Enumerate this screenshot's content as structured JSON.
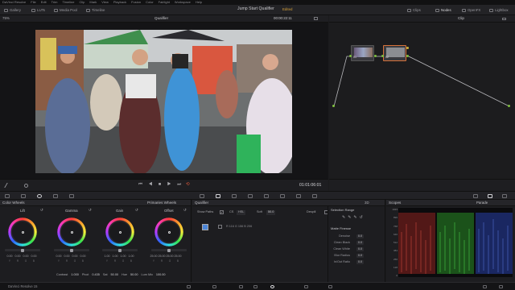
{
  "menu": [
    "DaVinci Resolve",
    "File",
    "Edit",
    "Trim",
    "Timeline",
    "Clip",
    "Mark",
    "View",
    "Playback",
    "Fusion",
    "Color",
    "Fairlight",
    "Workspace",
    "Help"
  ],
  "toolbar": {
    "left": [
      "Gallery",
      "LUTs",
      "Media Pool",
      "Timeline"
    ],
    "project_title": "Jump Start Qualifier",
    "project_status": "Edited",
    "right": [
      "Clips",
      "Nodes",
      "OpenFX",
      "Lightbox"
    ]
  },
  "viewer": {
    "zoom": "75%",
    "mode": "Qualifier",
    "timecode_top": "00:00:22:11",
    "timecode": "01:01:06:01"
  },
  "node_header": {
    "mode": "Clip"
  },
  "nodes": [
    {
      "num": "01"
    },
    {
      "num": "02"
    }
  ],
  "color_wheels": {
    "title": "Color Wheels",
    "tab": "Primaries Wheels",
    "wheels": [
      {
        "name": "Lift",
        "values": [
          "0.00",
          "0.00",
          "0.00",
          "0.00"
        ]
      },
      {
        "name": "Gamma",
        "values": [
          "0.00",
          "0.00",
          "0.00",
          "0.00"
        ]
      },
      {
        "name": "Gain",
        "values": [
          "1.00",
          "1.00",
          "1.00",
          "1.00"
        ]
      },
      {
        "name": "Offset",
        "values": [
          "25.00",
          "25.00",
          "25.00",
          "25.00"
        ]
      }
    ],
    "channels": [
      "Y",
      "R",
      "G",
      "B"
    ],
    "footer": [
      {
        "label": "Contrast",
        "value": "1.000"
      },
      {
        "label": "Pivot",
        "value": "0.435"
      },
      {
        "label": "Sat",
        "value": "50.00"
      },
      {
        "label": "Hue",
        "value": "50.00"
      },
      {
        "label": "Lum Mix",
        "value": "100.00"
      }
    ]
  },
  "qualifier": {
    "title": "Qualifier",
    "mode_3d": "3D",
    "show_paths": "Show Paths",
    "cs": "CS",
    "hsl": "HSL",
    "soft_label": "Soft",
    "soft_value": "50.0",
    "despill": "Despill",
    "readout": "R 116  G 156  B 206",
    "selection_range": "Selection Range",
    "matte_finesse": "Matte Finesse",
    "rows": [
      {
        "label": "Denoise",
        "value": "0.0"
      },
      {
        "label": "Clean Black",
        "value": "0.0"
      },
      {
        "label": "Clean White",
        "value": "0.0"
      },
      {
        "label": "Blur Radius",
        "value": "0.0"
      },
      {
        "label": "In/Out Ratio",
        "value": "0.0"
      }
    ]
  },
  "scopes": {
    "title": "Scopes",
    "mode": "Parade",
    "ticks": [
      "1023",
      "896",
      "768",
      "640",
      "512",
      "384",
      "256",
      "128",
      "0"
    ]
  },
  "footer": {
    "app": "DaVinci Resolve 15"
  },
  "colors": {
    "accent_orange": "#d7a23b",
    "node_green": "#7fbf3f",
    "node_yellow": "#d0b63a"
  }
}
